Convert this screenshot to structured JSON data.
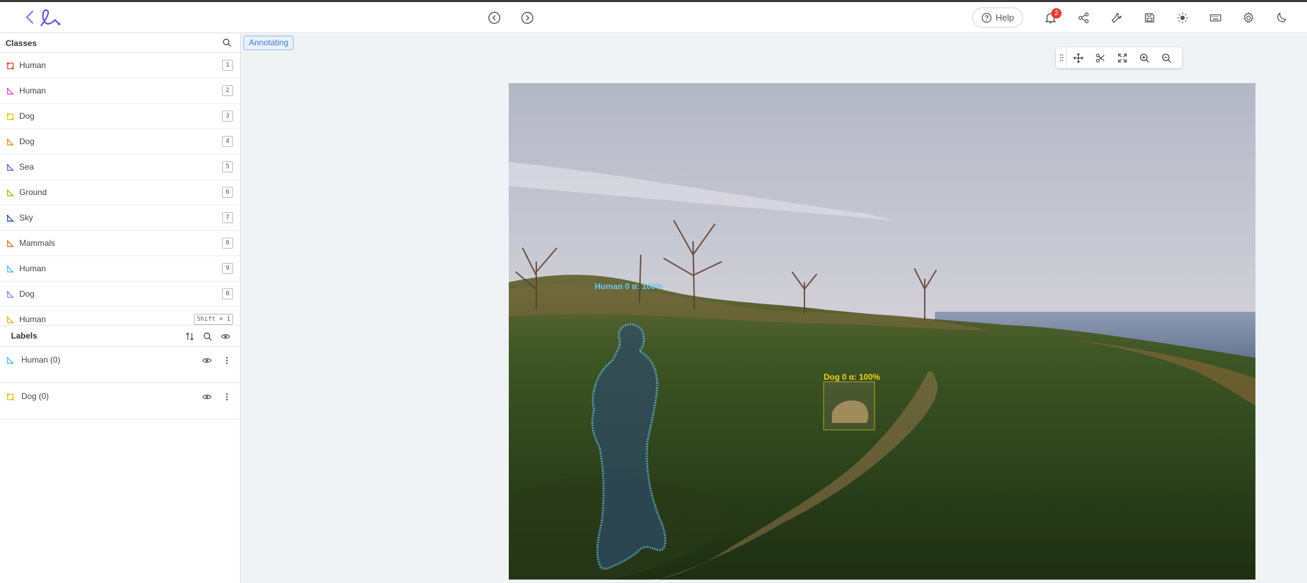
{
  "topbar": {
    "help_label": "Help",
    "notification_count": "2",
    "icons": [
      "back-chevron-icon",
      "logo-icon",
      "previous-icon",
      "next-icon",
      "help-icon",
      "bell-icon",
      "share-icon",
      "wrench-icon",
      "save-icon",
      "sun-icon",
      "keyboard-icon",
      "gear-icon",
      "moon-icon"
    ]
  },
  "classes": {
    "title": "Classes",
    "items": [
      {
        "label": "Human",
        "key": "1",
        "color": "#e8553a"
      },
      {
        "label": "Human",
        "key": "2",
        "color": "#d94fd9"
      },
      {
        "label": "Dog",
        "key": "3",
        "color": "#e6c619"
      },
      {
        "label": "Dog",
        "key": "4",
        "color": "#e89a2a"
      },
      {
        "label": "Sea",
        "key": "5",
        "color": "#6d6de0"
      },
      {
        "label": "Ground",
        "key": "6",
        "color": "#a7c21c"
      },
      {
        "label": "Sky",
        "key": "7",
        "color": "#3b4fb8"
      },
      {
        "label": "Mammals",
        "key": "8",
        "color": "#e07b2a"
      },
      {
        "label": "Human",
        "key": "9",
        "color": "#55c3e8"
      },
      {
        "label": "Dog",
        "key": "0",
        "color": "#8d8de6"
      },
      {
        "label": "Human",
        "key": "Shift + 1",
        "color": "#e6b52a"
      }
    ]
  },
  "labels": {
    "title": "Labels",
    "items": [
      {
        "text": "Human (0)",
        "color": "#55c3e8"
      },
      {
        "text": "Dog (0)",
        "color": "#e6c619"
      }
    ]
  },
  "mode": "Annotating",
  "annotations": {
    "human_label": "Human 0 α: 100%",
    "human_color": "#6cc7f0",
    "dog_label": "Dog 0 α: 100%",
    "dog_color": "#f2d21b"
  },
  "accent_color": "#6f6fd8"
}
